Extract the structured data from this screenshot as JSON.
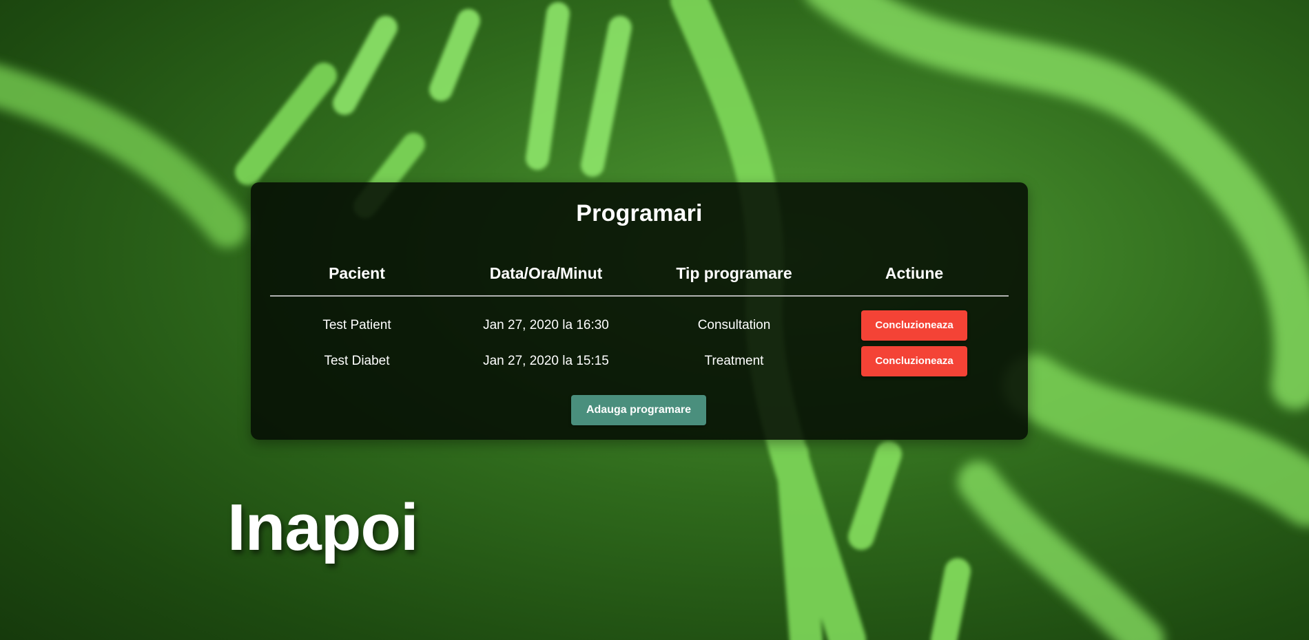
{
  "page": {
    "accent_color": "#4a8f7d",
    "danger_color": "#f44336",
    "background_theme": "green DNA strands"
  },
  "appointments": {
    "title": "Programari",
    "columns": [
      "Pacient",
      "Data/Ora/Minut",
      "Tip programare",
      "Actiune"
    ],
    "rows": [
      {
        "patient": "Test Patient",
        "datetime": "Jan 27, 2020 la 16:30",
        "type": "Consultation",
        "action_label": "Concluzioneaza"
      },
      {
        "patient": "Test Diabet",
        "datetime": "Jan 27, 2020 la 15:15",
        "type": "Treatment",
        "action_label": "Concluzioneaza"
      }
    ],
    "add_button_label": "Adauga programare"
  },
  "navigation": {
    "back_label": "Inapoi"
  }
}
